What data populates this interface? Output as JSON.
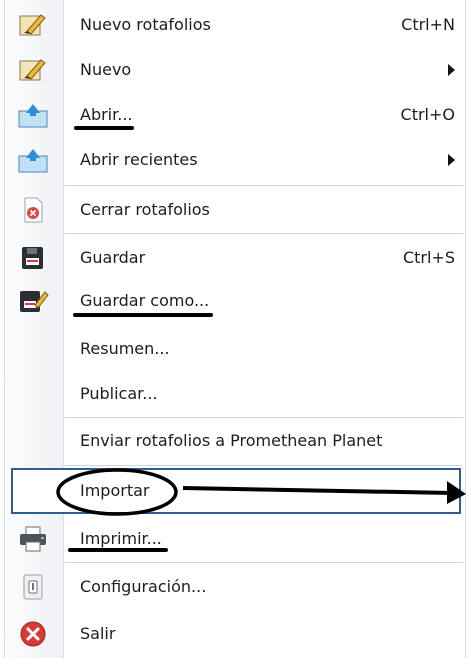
{
  "menu": {
    "items": [
      {
        "label": "Nuevo rotafolios",
        "shortcut": "Ctrl+N",
        "icon": "flipchart-new-icon"
      },
      {
        "label": "Nuevo",
        "shortcut": "",
        "icon": "flipchart-new-icon",
        "submenu": true
      },
      {
        "label": "Abrir...",
        "shortcut": "Ctrl+O",
        "icon": "open-folder-icon"
      },
      {
        "label": "Abrir recientes",
        "shortcut": "",
        "icon": "open-folder-icon",
        "submenu": true
      },
      {
        "label": "Cerrar rotafolios",
        "shortcut": "",
        "icon": "close-document-icon"
      },
      {
        "label": "Guardar",
        "shortcut": "Ctrl+S",
        "icon": "save-icon"
      },
      {
        "label": "Guardar como...",
        "shortcut": "",
        "icon": "save-as-icon"
      },
      {
        "label": "Resumen...",
        "shortcut": "",
        "icon": ""
      },
      {
        "label": "Publicar...",
        "shortcut": "",
        "icon": ""
      },
      {
        "label": "Enviar rotafolios a Promethean Planet",
        "shortcut": "",
        "icon": ""
      },
      {
        "label": "Importar",
        "shortcut": "",
        "icon": "",
        "highlighted": true
      },
      {
        "label": "Imprimir...",
        "shortcut": "",
        "icon": "printer-icon"
      },
      {
        "label": "Configuración...",
        "shortcut": "",
        "icon": "settings-icon"
      },
      {
        "label": "Salir",
        "shortcut": "",
        "icon": "exit-icon"
      }
    ]
  },
  "colors": {
    "highlight_border": "#2f5e93",
    "separator": "#d0d4da",
    "exit_red": "#d83a3a"
  }
}
